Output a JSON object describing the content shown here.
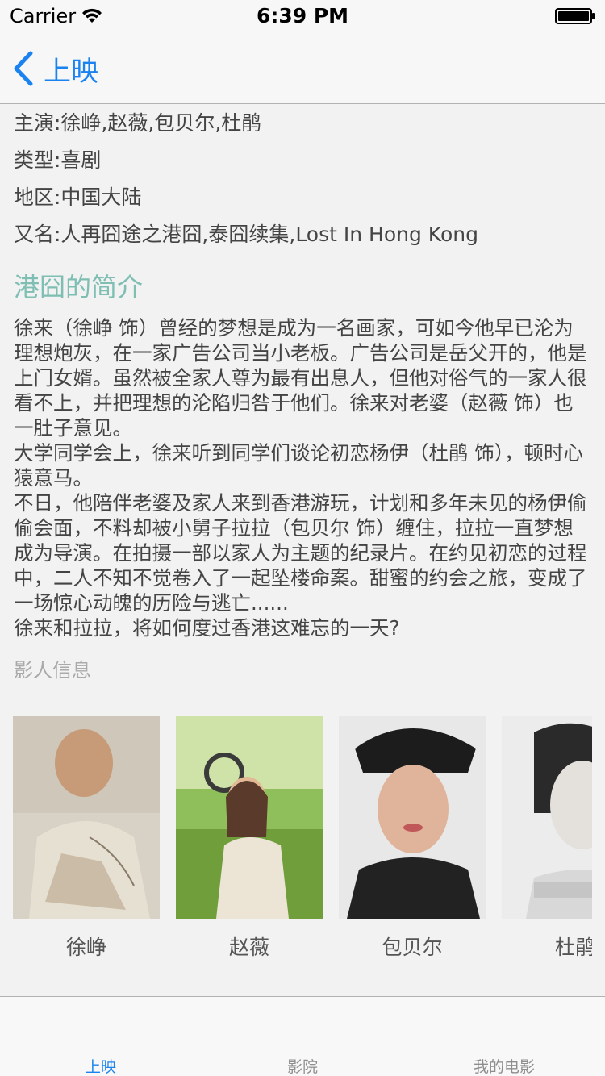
{
  "status_bar": {
    "carrier": "Carrier",
    "time": "6:39 PM"
  },
  "nav": {
    "back_label": "上映"
  },
  "movie": {
    "cast_line": "主演:徐峥,赵薇,包贝尔,杜鹃",
    "genre_line": "类型:喜剧",
    "region_line": "地区:中国大陆",
    "alias_line": "又名:人再囧途之港囧,泰囧续集,Lost In Hong Kong"
  },
  "synopsis": {
    "title": "港囧的简介",
    "paragraphs": [
      "徐来（徐峥 饰）曾经的梦想是成为一名画家，可如今他早已沦为理想炮灰，在一家广告公司当小老板。广告公司是岳父开的，他是上门女婿。虽然被全家人尊为最有出息人，但他对俗气的一家人很看不上，并把理想的沦陷归咎于他们。徐来对老婆（赵薇 饰）也一肚子意见。",
      "大学同学会上，徐来听到同学们谈论初恋杨伊（杜鹃 饰），顿时心猿意马。",
      "不日，他陪伴老婆及家人来到香港游玩，计划和多年未见的杨伊偷偷会面，不料却被小舅子拉拉（包贝尔 饰）缠住，拉拉一直梦想成为导演。在拍摄一部以家人为主题的纪录片。在约见初恋的过程中，二人不知不觉卷入了一起坠楼命案。甜蜜的约会之旅，变成了一场惊心动魄的历险与逃亡......",
      "徐来和拉拉，将如何度过香港这难忘的一天?"
    ]
  },
  "people": {
    "label": "影人信息",
    "cast": [
      {
        "name": "徐峥"
      },
      {
        "name": "赵薇"
      },
      {
        "name": "包贝尔"
      },
      {
        "name": "杜鹃"
      }
    ]
  },
  "tabs": [
    {
      "label": "上映",
      "active": true
    },
    {
      "label": "影院",
      "active": false
    },
    {
      "label": "我的电影",
      "active": false
    }
  ],
  "colors": {
    "accent": "#1a83f0",
    "section_title": "#7fbfb3"
  }
}
